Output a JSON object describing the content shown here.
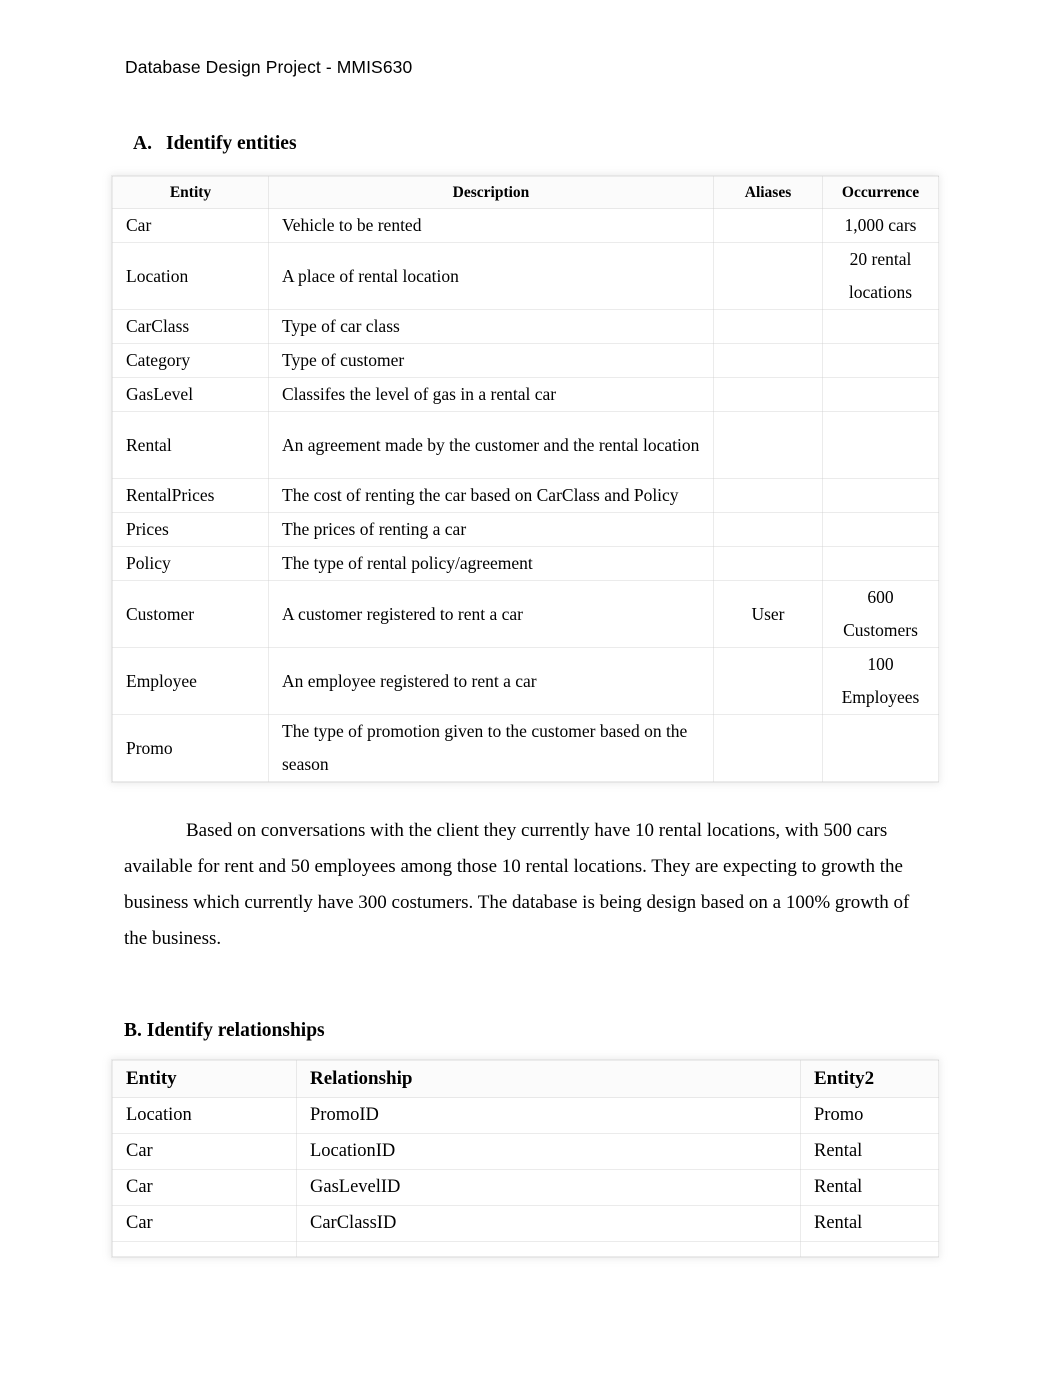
{
  "document": {
    "running_header": "Database Design Project - MMIS630"
  },
  "section_a": {
    "marker": "A.",
    "title": "Identify entities",
    "table": {
      "columns": [
        "Entity",
        "Description",
        "Aliases",
        "Occurrence"
      ],
      "rows": [
        {
          "entity": "Car",
          "description": "Vehicle to be rented",
          "aliases": "",
          "occurrence": "1,000 cars",
          "occurrence_lines": [
            "1,000 cars"
          ],
          "two_line": false
        },
        {
          "entity": "Location",
          "description": "A place of rental location",
          "aliases": "",
          "occurrence": "20 rental locations",
          "occurrence_lines": [
            "20 rental",
            "locations"
          ],
          "two_line": true
        },
        {
          "entity": "CarClass",
          "description": "Type of car class",
          "aliases": "",
          "occurrence": "",
          "occurrence_lines": [],
          "two_line": false
        },
        {
          "entity": "Category",
          "description": "Type of customer",
          "aliases": "",
          "occurrence": "",
          "occurrence_lines": [],
          "two_line": false
        },
        {
          "entity": "GasLevel",
          "description": "Classifes the level of gas in a rental car",
          "aliases": "",
          "occurrence": "",
          "occurrence_lines": [],
          "two_line": false
        },
        {
          "entity": "Rental",
          "description": "An agreement made by the customer and the rental location",
          "aliases": "",
          "occurrence": "",
          "occurrence_lines": [],
          "two_line": true
        },
        {
          "entity": "RentalPrices",
          "description": "The cost of renting the car based on CarClass and Policy",
          "aliases": "",
          "occurrence": "",
          "occurrence_lines": [],
          "two_line": false
        },
        {
          "entity": "Prices",
          "description": "The prices of renting a car",
          "aliases": "",
          "occurrence": "",
          "occurrence_lines": [],
          "two_line": false
        },
        {
          "entity": "Policy",
          "description": "The type of rental policy/agreement",
          "aliases": "",
          "occurrence": "",
          "occurrence_lines": [],
          "two_line": false
        },
        {
          "entity": "Customer",
          "description": "A customer registered to rent a car",
          "aliases": "User",
          "occurrence": "600 Customers",
          "occurrence_lines": [
            "600",
            "Customers"
          ],
          "two_line": true
        },
        {
          "entity": "Employee",
          "description": "An employee registered to rent a car",
          "aliases": "",
          "occurrence": "100 Employees",
          "occurrence_lines": [
            "100",
            "Employees"
          ],
          "two_line": true
        },
        {
          "entity": "Promo",
          "description": "The type of promotion given to the customer based on the season",
          "aliases": "",
          "occurrence": "",
          "occurrence_lines": [],
          "two_line": true
        }
      ]
    }
  },
  "paragraph": {
    "text": "Based on conversations with the client they currently have 10 rental locations, with 500 cars available for rent and 50 employees among those 10 rental locations. They are expecting to growth the business which currently have 300 costumers. The database is being design based on a 100% growth of the business."
  },
  "section_b": {
    "title": "B. Identify relationships",
    "table": {
      "columns": [
        "Entity",
        "Relationship",
        "Entity2"
      ],
      "rows": [
        {
          "entity": "Location",
          "relationship": "PromoID",
          "entity2": "Promo"
        },
        {
          "entity": "Car",
          "relationship": "LocationID",
          "entity2": "Rental"
        },
        {
          "entity": "Car",
          "relationship": "GasLevelID",
          "entity2": "Rental"
        },
        {
          "entity": "Car",
          "relationship": "CarClassID",
          "entity2": "Rental"
        }
      ]
    }
  },
  "colors": {
    "page_background": "#ffffff",
    "text": "#000000",
    "table_border": "#cdcdcd",
    "header_row_background": "#fbfbfb"
  }
}
